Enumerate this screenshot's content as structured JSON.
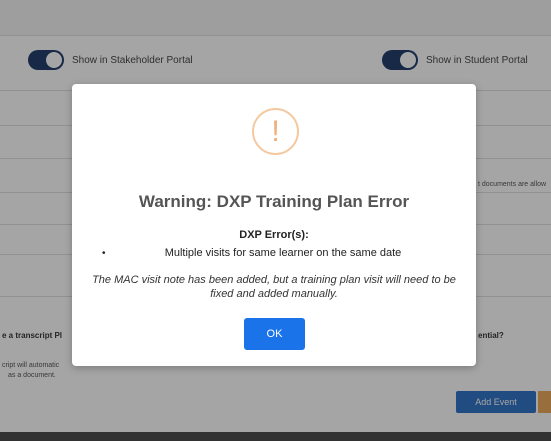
{
  "background": {
    "stakeholder_toggle_label": "Show in Stakeholder Portal",
    "student_toggle_label": "Show in Student Portal",
    "right_cut_text": "t documents are allow",
    "transcript_question": "e a transcript Pl",
    "transcript_hint_line1": "cript will automatic",
    "transcript_hint_line2": "as a document.",
    "credential_question": "ential?",
    "add_event_label": "Add Event"
  },
  "modal": {
    "icon_glyph": "!",
    "title": "Warning: DXP Training Plan Error",
    "errors_heading": "DXP Error(s):",
    "errors": [
      "Multiple visits for same learner on the same date"
    ],
    "note": "The MAC visit note has been added, but a training plan visit will need to be fixed and added manually.",
    "ok_label": "OK"
  },
  "colors": {
    "primary": "#1a73e8",
    "warning": "#f0ae78",
    "toggle_on": "#0b2a5e"
  }
}
